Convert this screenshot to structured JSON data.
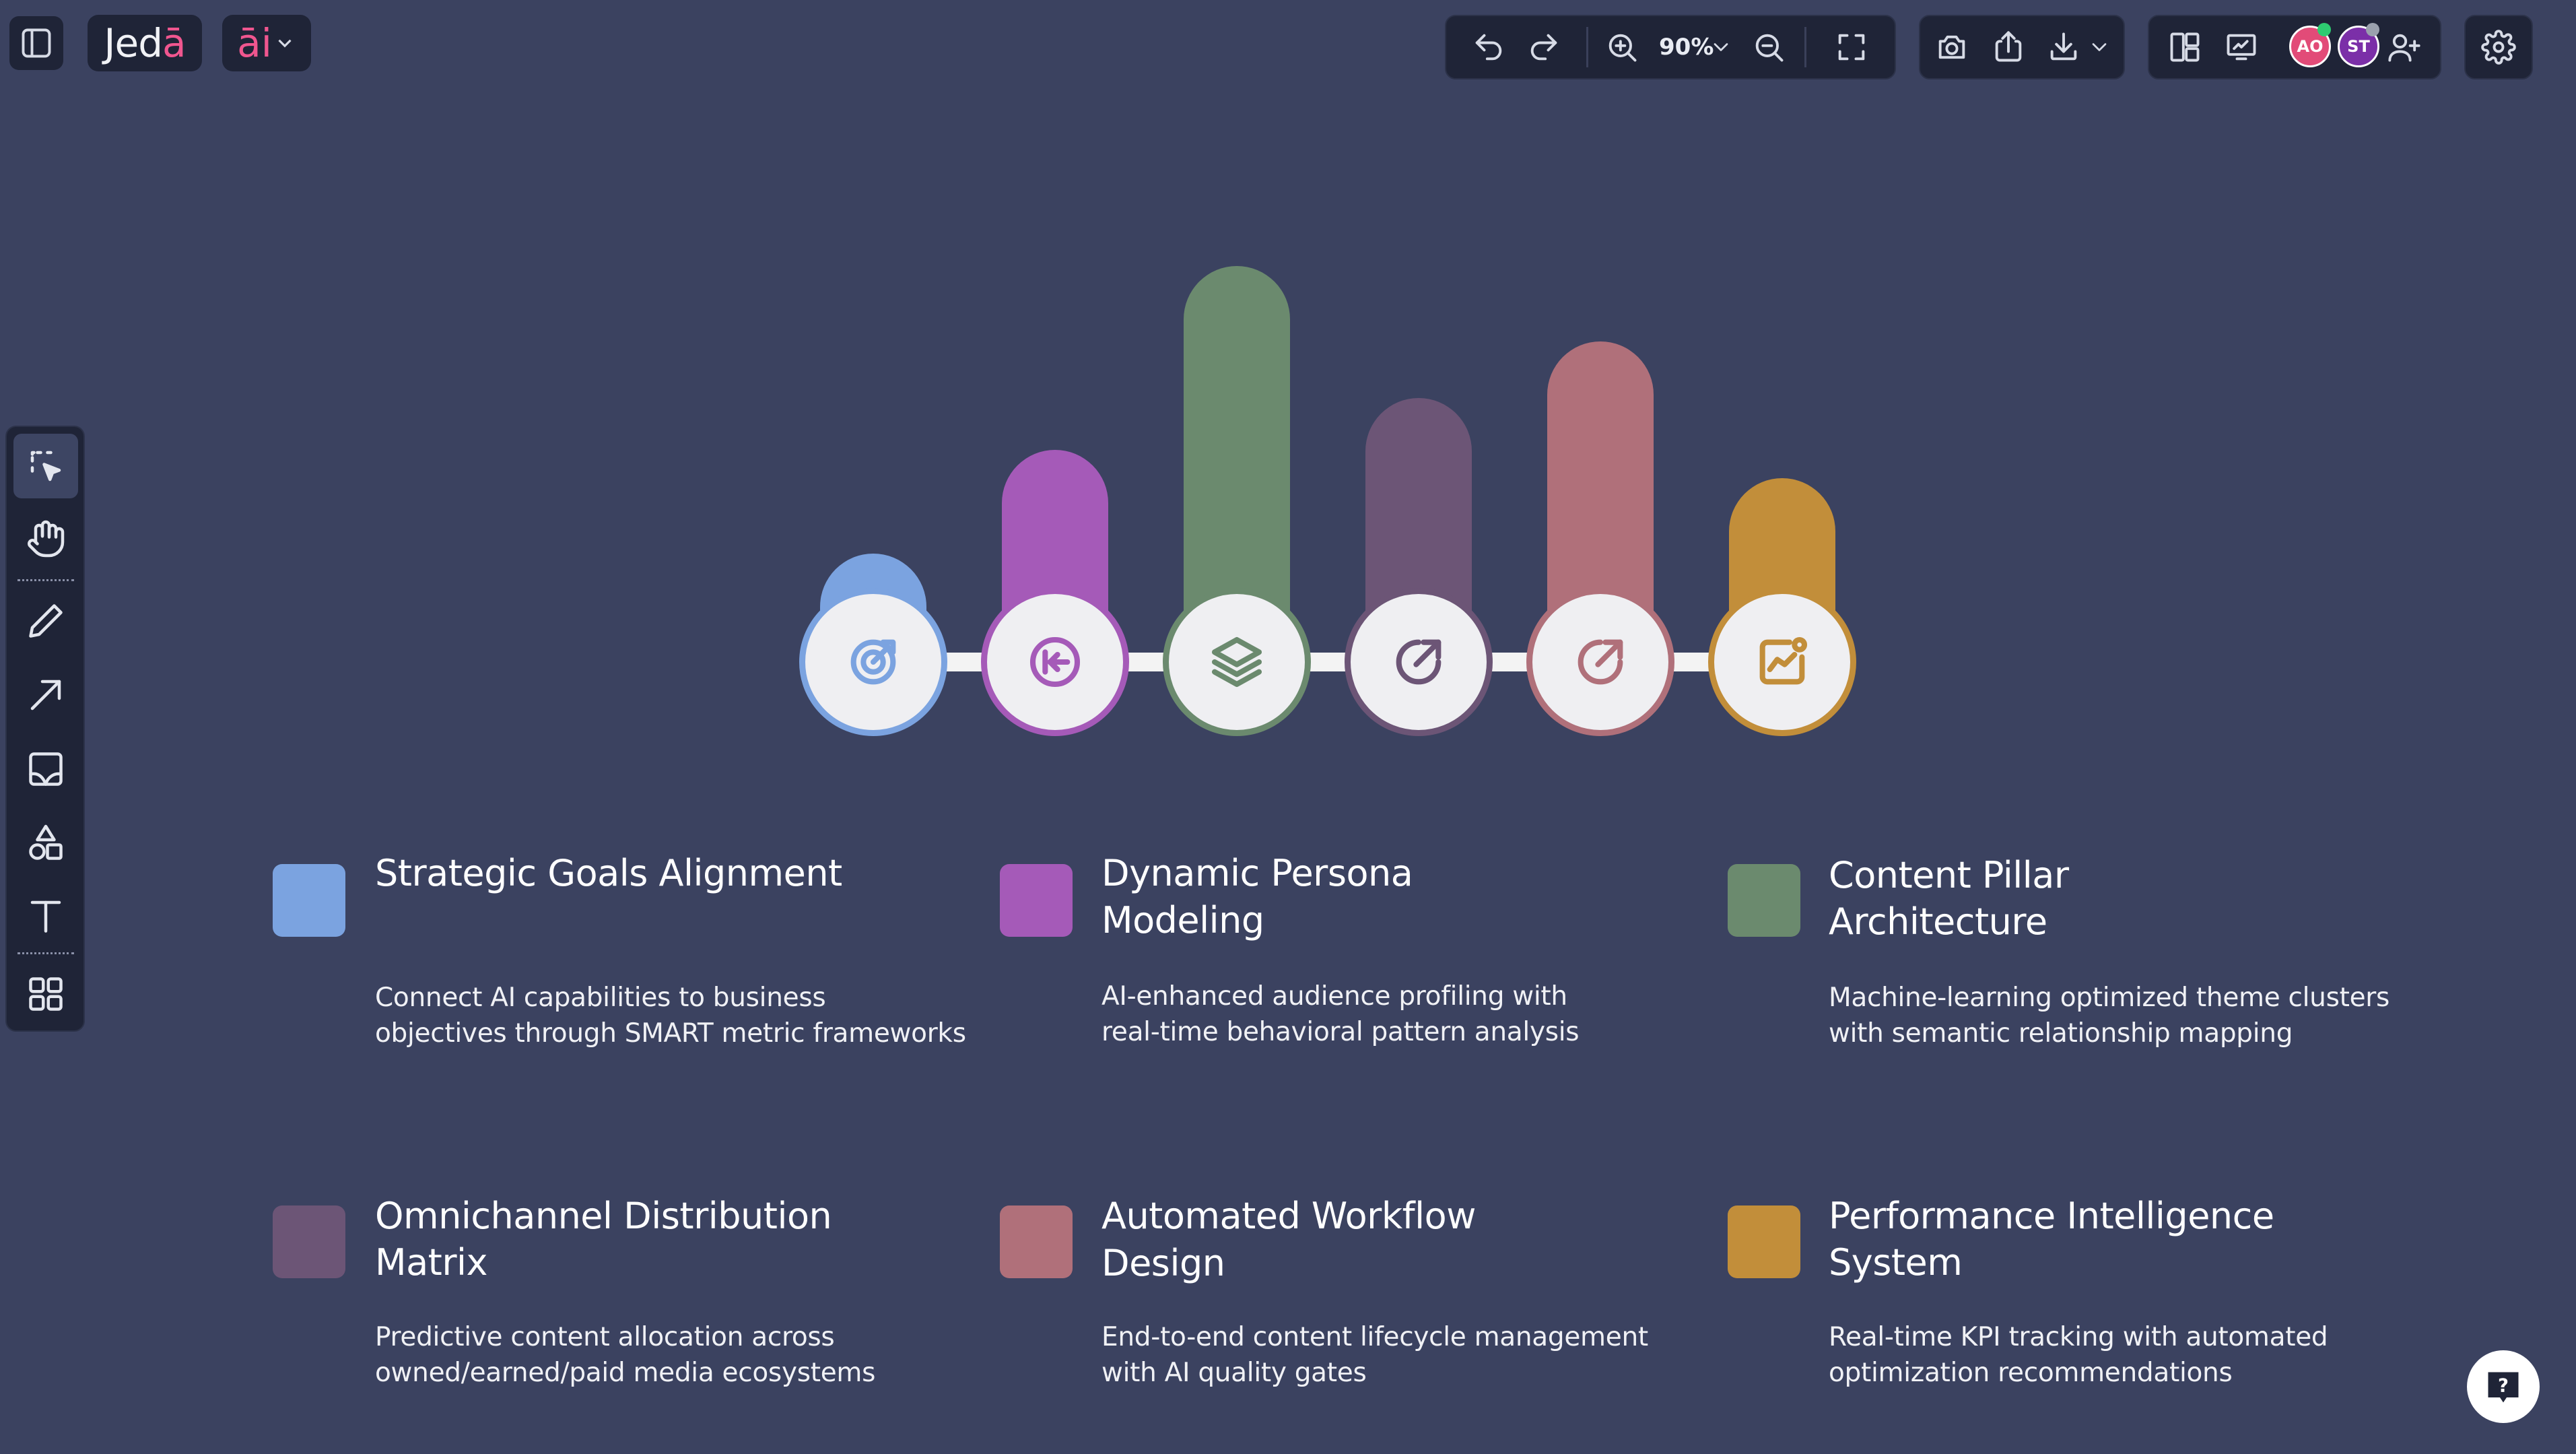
{
  "app": {
    "logo_main": "Jed",
    "logo_accent": "ā",
    "ai_label": "āi"
  },
  "toolbar": {
    "zoom": "90%",
    "avatars": [
      {
        "initials": "AO",
        "color": "#e24b78",
        "status": "#2ecc71"
      },
      {
        "initials": "ST",
        "color": "#7b2fa8",
        "status": "#9aa0ad"
      }
    ]
  },
  "left_tools": [
    "select",
    "hand",
    "pencil",
    "arrow",
    "image",
    "shapes",
    "text",
    "components"
  ],
  "chart_data": {
    "type": "bar",
    "categories": [
      "Strategic Goals Alignment",
      "Dynamic Persona Modeling",
      "Content Pillar Architecture",
      "Omnichannel Distribution Matrix",
      "Automated Workflow Design",
      "Performance Intelligence System"
    ],
    "values": [
      2.3,
      4.5,
      8.4,
      5.6,
      6.8,
      3.9
    ],
    "colors": [
      "#7ba3e0",
      "#a55ab8",
      "#6b8a6e",
      "#6c5576",
      "#b0707a",
      "#c28e3a"
    ],
    "icons": [
      "target-icon",
      "arrow-left-to-line-icon",
      "layers-icon",
      "arrow-up-right-icon",
      "arrow-up-right-icon",
      "chart-trend-icon"
    ]
  },
  "cards": [
    {
      "title": "Strategic Goals Alignment",
      "desc_line1": "Connect AI capabilities to business",
      "desc_line2": "objectives through SMART metric frameworks",
      "color": "#7ba3e0"
    },
    {
      "title": "Dynamic Persona Modeling",
      "desc_line1": "AI-enhanced audience profiling with",
      "desc_line2": "real-time behavioral pattern analysis",
      "color": "#a55ab8"
    },
    {
      "title_line1": "Content Pillar",
      "title_line2": "Architecture",
      "desc_line1": "Machine-learning optimized theme clusters",
      "desc_line2": "with semantic relationship mapping",
      "color": "#6b8a6e"
    },
    {
      "title_line1": "Omnichannel Distribution",
      "title_line2": "Matrix",
      "desc_line1": "Predictive content allocation across",
      "desc_line2": "owned/earned/paid media ecosystems",
      "color": "#6c5576"
    },
    {
      "title": "Automated Workflow Design",
      "desc_line1": "End-to-end content lifecycle management",
      "desc_line2": "with AI quality gates",
      "color": "#b0707a"
    },
    {
      "title_line1": "Performance Intelligence",
      "title_line2": "System",
      "desc_line1": "Real-time KPI tracking with automated",
      "desc_line2": "optimization recommendations",
      "color": "#c28e3a"
    }
  ],
  "help_label": "?"
}
